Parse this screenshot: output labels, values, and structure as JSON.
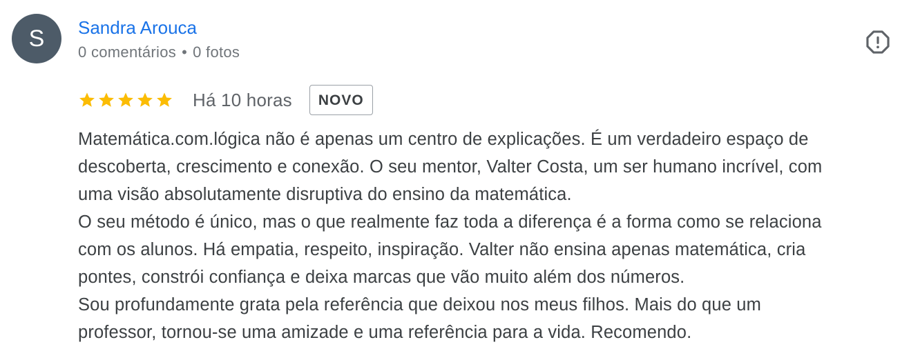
{
  "review": {
    "author": {
      "initial": "S",
      "name": "Sandra Arouca",
      "comments": "0 comentários",
      "separator": "•",
      "photos": "0 fotos",
      "avatar_color": "#4d5b68",
      "name_color": "#1a73e8"
    },
    "rating": {
      "stars": 5,
      "max_stars": 5,
      "star_color": "#fbbc04",
      "time": "Há 10 horas",
      "badge": "NOVO"
    },
    "flag_icon": "report-flag-icon",
    "text_lines": [
      "Matemática.com.lógica não é apenas um centro de explicações. É um verdadeiro espaço de",
      "descoberta, crescimento e conexão. O seu mentor, Valter Costa, um ser humano incrível, com",
      "uma visão absolutamente disruptiva do ensino da matemática.",
      "O seu método é único, mas o que realmente faz toda a diferença é a forma como se relaciona",
      "com os alunos. Há empatia, respeito, inspiração. Valter não ensina apenas matemática, cria",
      "pontes, constrói confiança e deixa marcas que vão muito além dos números.",
      "Sou profundamente grata pela referência que deixou nos meus filhos. Mais do que um",
      "professor, tornou-se uma amizade e uma referência para a vida. Recomendo."
    ]
  }
}
